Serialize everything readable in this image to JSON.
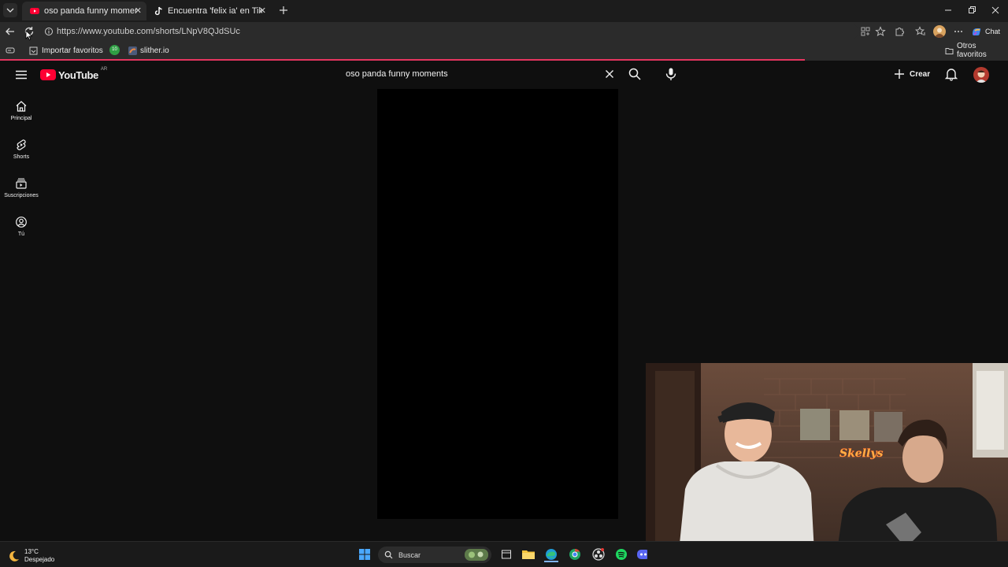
{
  "browser": {
    "tabs": [
      {
        "title": "oso panda funny moments - YouTube",
        "active": true
      },
      {
        "title": "Encuentra 'felix ia' en TikTok | Búsqueda",
        "active": false
      }
    ],
    "url": "https://www.youtube.com/shorts/LNpV8QJdSUc",
    "bookmarks": [
      {
        "label": "Importar favoritos"
      },
      {
        "label": "10"
      },
      {
        "label": "slither.io"
      }
    ],
    "other_favorites": "Otros favoritos",
    "copilot_label": "Chat"
  },
  "youtube": {
    "logo_text": "YouTube",
    "country_code": "AR",
    "search_value": "oso panda funny moments",
    "create_label": "Crear",
    "nav": [
      {
        "label": "Principal"
      },
      {
        "label": "Shorts"
      },
      {
        "label": "Suscripciones"
      },
      {
        "label": "Tú"
      }
    ]
  },
  "overlay": {
    "neon_sign": "Skellys"
  },
  "taskbar": {
    "temperature": "13°C",
    "weather": "Despejado",
    "search_label": "Buscar"
  },
  "colors": {
    "brand_red": "#ff0033",
    "loading_bar": "#e5355f",
    "spotify_green": "#1ed760"
  }
}
